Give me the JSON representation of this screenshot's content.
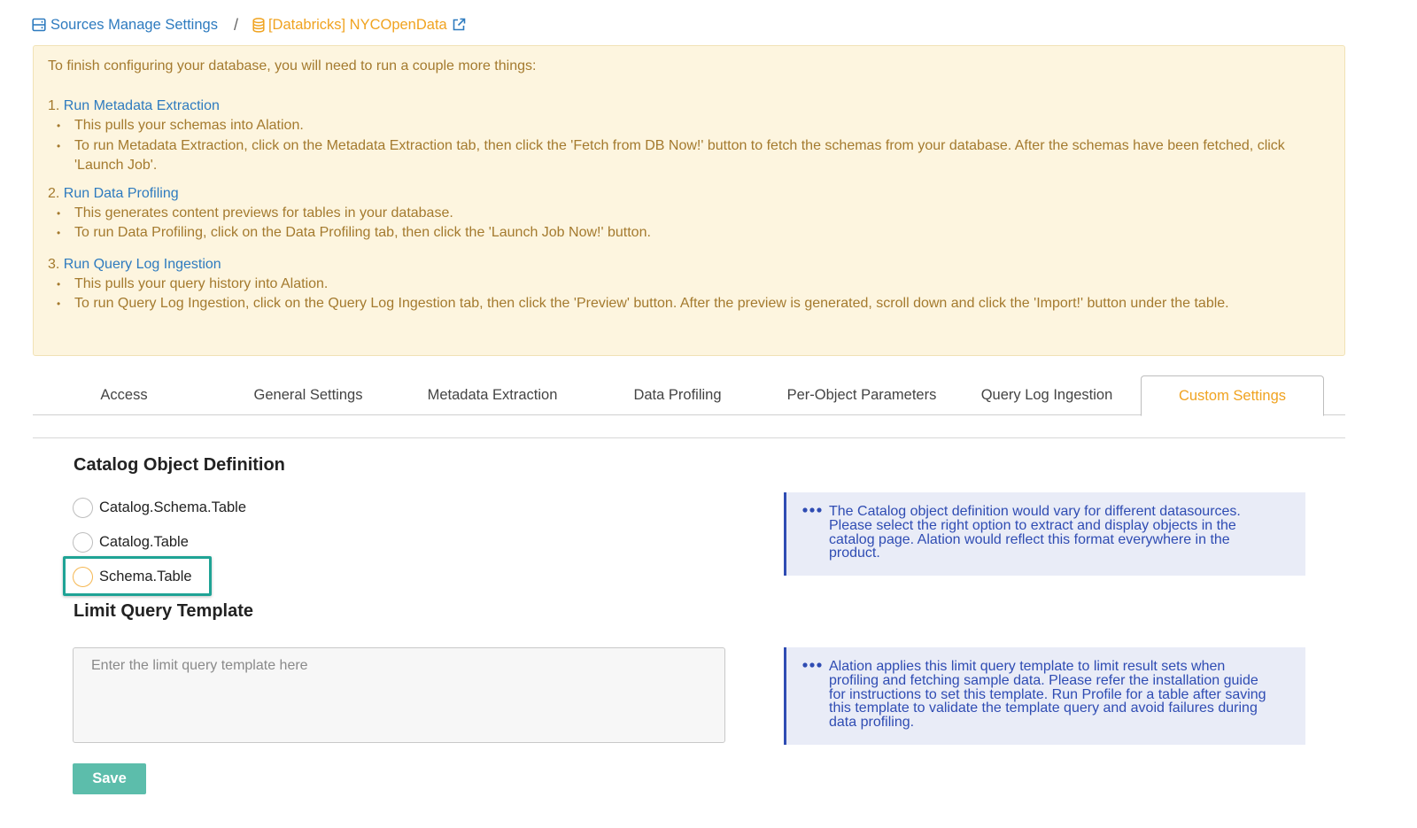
{
  "breadcrumb": {
    "parent_label": "Sources Manage Settings",
    "separator": "/",
    "current_label": "[Databricks] NYCOpenData"
  },
  "banner": {
    "intro": "To finish configuring your database, you will need to run a couple more things:",
    "steps": [
      {
        "number": "1.",
        "title": "Run Metadata Extraction",
        "bullets": [
          "This pulls your schemas into Alation.",
          "To run Metadata Extraction, click on the Metadata Extraction tab, then click the 'Fetch from DB Now!' button to fetch the schemas from your database. After the schemas have been fetched, click 'Launch Job'."
        ]
      },
      {
        "number": "2.",
        "title": "Run Data Profiling",
        "bullets": [
          "This generates content previews for tables in your database.",
          "To run Data Profiling, click on the Data Profiling tab, then click the 'Launch Job Now!' button."
        ]
      },
      {
        "number": "3.",
        "title": "Run Query Log Ingestion",
        "bullets": [
          "This pulls your query history into Alation.",
          "To run Query Log Ingestion, click on the Query Log Ingestion tab, then click the 'Preview' button. After the preview is generated, scroll down and click the 'Import!' button under the table."
        ]
      }
    ]
  },
  "tabs": [
    {
      "label": "Access"
    },
    {
      "label": "General Settings"
    },
    {
      "label": "Metadata Extraction"
    },
    {
      "label": "Data Profiling"
    },
    {
      "label": "Per-Object Parameters"
    },
    {
      "label": "Query Log Ingestion"
    },
    {
      "label": "Custom Settings",
      "active": true
    }
  ],
  "catalog_section": {
    "title": "Catalog Object Definition",
    "options": [
      "Catalog.Schema.Table",
      "Catalog.Table",
      "Schema.Table"
    ],
    "help": "The Catalog object definition would vary for different datasources. Please select the right option to extract and display objects in the catalog page. Alation would reflect this format everywhere in the product."
  },
  "limit_section": {
    "title": "Limit Query Template",
    "placeholder": "Enter the limit query template here",
    "help": "Alation applies this limit query template to limit result sets when profiling and fetching sample data. Please refer the installation guide for instructions to set this template. Run Profile for a table after saving this template to validate the template query and avoid failures during data profiling."
  },
  "save_label": "Save",
  "colors": {
    "link_blue": "#2e7bbf",
    "accent_orange": "#f0a320",
    "banner_bg": "#fdf5df",
    "banner_text": "#a47a2e",
    "help_bg": "#e9ecf7",
    "help_text": "#2f4cb3",
    "save_bg": "#5cbdab",
    "highlight_teal": "#1fa395"
  },
  "icons": {
    "breadcrumb_parent": "server-icon",
    "breadcrumb_current": "database-icon",
    "external": "external-link-icon",
    "help": "ellipsis-icon"
  }
}
